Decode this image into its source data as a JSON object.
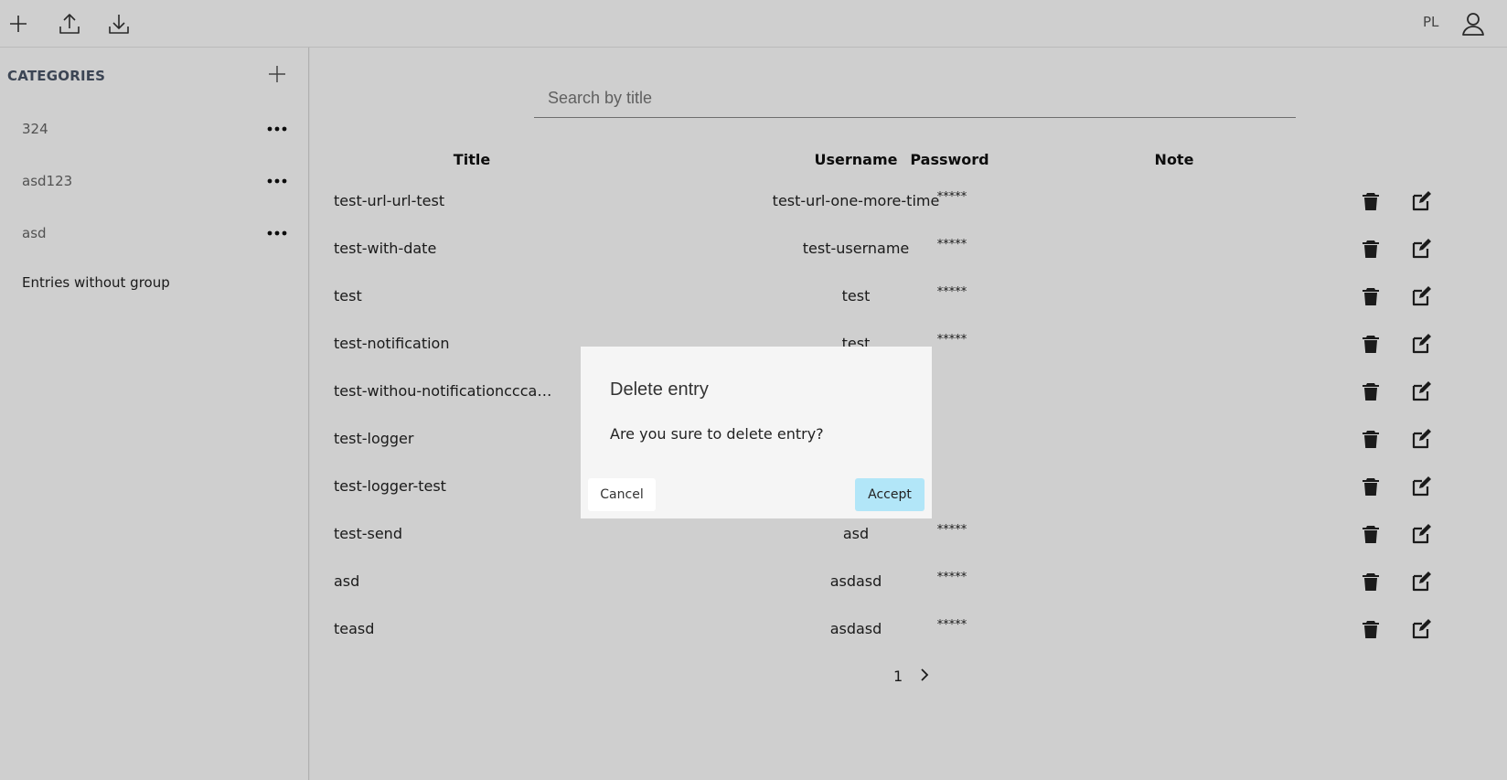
{
  "topbar": {
    "icons": [
      "plus-icon",
      "upload-icon",
      "download-icon",
      "user-icon"
    ],
    "lang": "PL"
  },
  "sidebar": {
    "title": "CATEGORIES",
    "items": [
      {
        "label": "324"
      },
      {
        "label": "asd123"
      },
      {
        "label": "asd"
      }
    ],
    "no_group": "Entries without group"
  },
  "search": {
    "placeholder": "Search by title"
  },
  "table": {
    "headers": {
      "title": "Title",
      "username": "Username",
      "password": "Password",
      "note": "Note"
    },
    "rows": [
      {
        "title": "test-url-url-test",
        "username": "test-url-one-more-time",
        "password": "*****",
        "note": ""
      },
      {
        "title": "test-with-date",
        "username": "test-username",
        "password": "*****",
        "note": ""
      },
      {
        "title": "test",
        "username": "test",
        "password": "*****",
        "note": ""
      },
      {
        "title": "test-notification",
        "username": "test",
        "password": "*****",
        "note": ""
      },
      {
        "title": "test-withou-notificationcccasda...",
        "username": "",
        "password": "",
        "note": ""
      },
      {
        "title": "test-logger",
        "username": "",
        "password": "",
        "note": ""
      },
      {
        "title": "test-logger-test",
        "username": "",
        "password": "",
        "note": ""
      },
      {
        "title": "test-send",
        "username": "asd",
        "password": "*****",
        "note": ""
      },
      {
        "title": "asd",
        "username": "asdasd",
        "password": "*****",
        "note": ""
      },
      {
        "title": "teasd",
        "username": "asdasd",
        "password": "*****",
        "note": ""
      }
    ]
  },
  "pagination": {
    "current": "1"
  },
  "dialog": {
    "title": "Delete entry",
    "message": "Are you sure to delete entry?",
    "cancel_label": "Cancel",
    "accept_label": "Accept"
  },
  "colors": {
    "accept": "#b2e6f8",
    "overlay": "rgba(0,0,0,0.19)"
  }
}
